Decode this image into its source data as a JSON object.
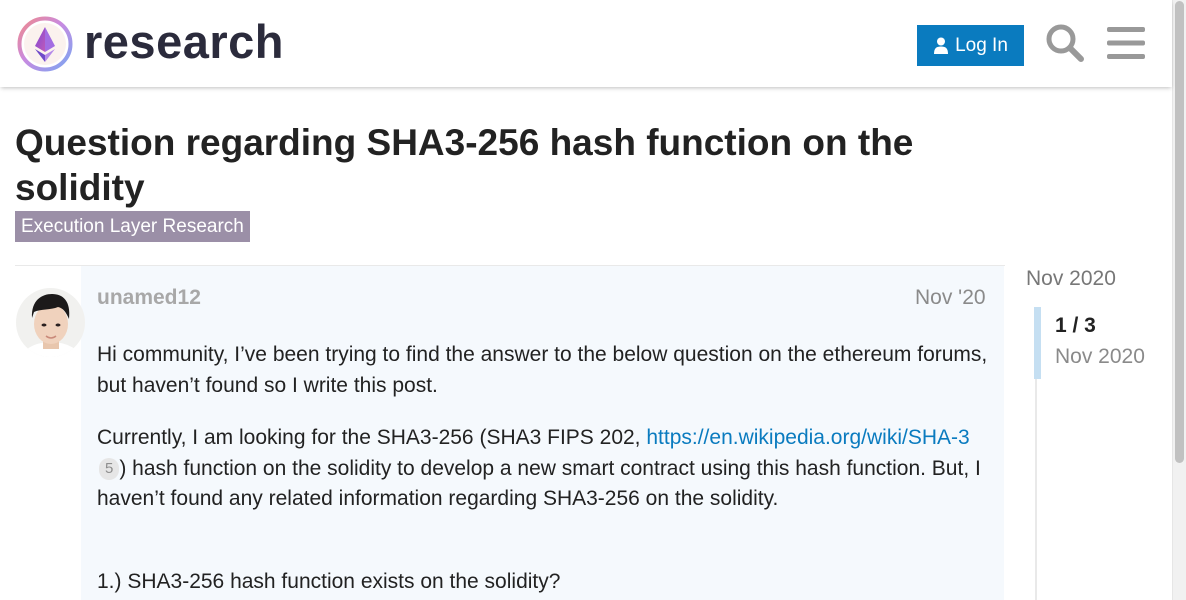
{
  "header": {
    "logo_text": "research",
    "login_label": "Log In"
  },
  "topic": {
    "title": "Question regarding SHA3-256 hash function on the solidity",
    "category": "Execution Layer Research",
    "category_color": "#9b8fa7"
  },
  "post": {
    "username": "unamed12",
    "date": "Nov '20",
    "paragraph1": "Hi community, I’ve been trying to find the answer to the below question on the ethereum forums, but haven’t found so I write this post.",
    "paragraph2_before": "Currently, I am looking for the SHA3-256 (SHA3 FIPS 202, ",
    "paragraph2_link": "https://en.wikipedia.org/wiki/SHA-3",
    "paragraph2_link_clicks": "5",
    "paragraph2_after": ") hash function on the solidity to develop a new smart contract using this hash function. But, I haven’t found any related information regarding SHA3-256 on the solidity.",
    "paragraph3": "1.) SHA3-256 hash function exists on the solidity?"
  },
  "timeline": {
    "top_date": "Nov 2020",
    "counter": "1 / 3",
    "current_date": "Nov 2020",
    "progress_fraction": 0.33
  },
  "colors": {
    "accent": "#0a7bbf",
    "post_background": "#f5f9fd"
  },
  "icons": {
    "logo": "ethereum-research-logo-icon",
    "login": "user-icon",
    "search": "search-icon",
    "menu": "hamburger-menu-icon"
  }
}
